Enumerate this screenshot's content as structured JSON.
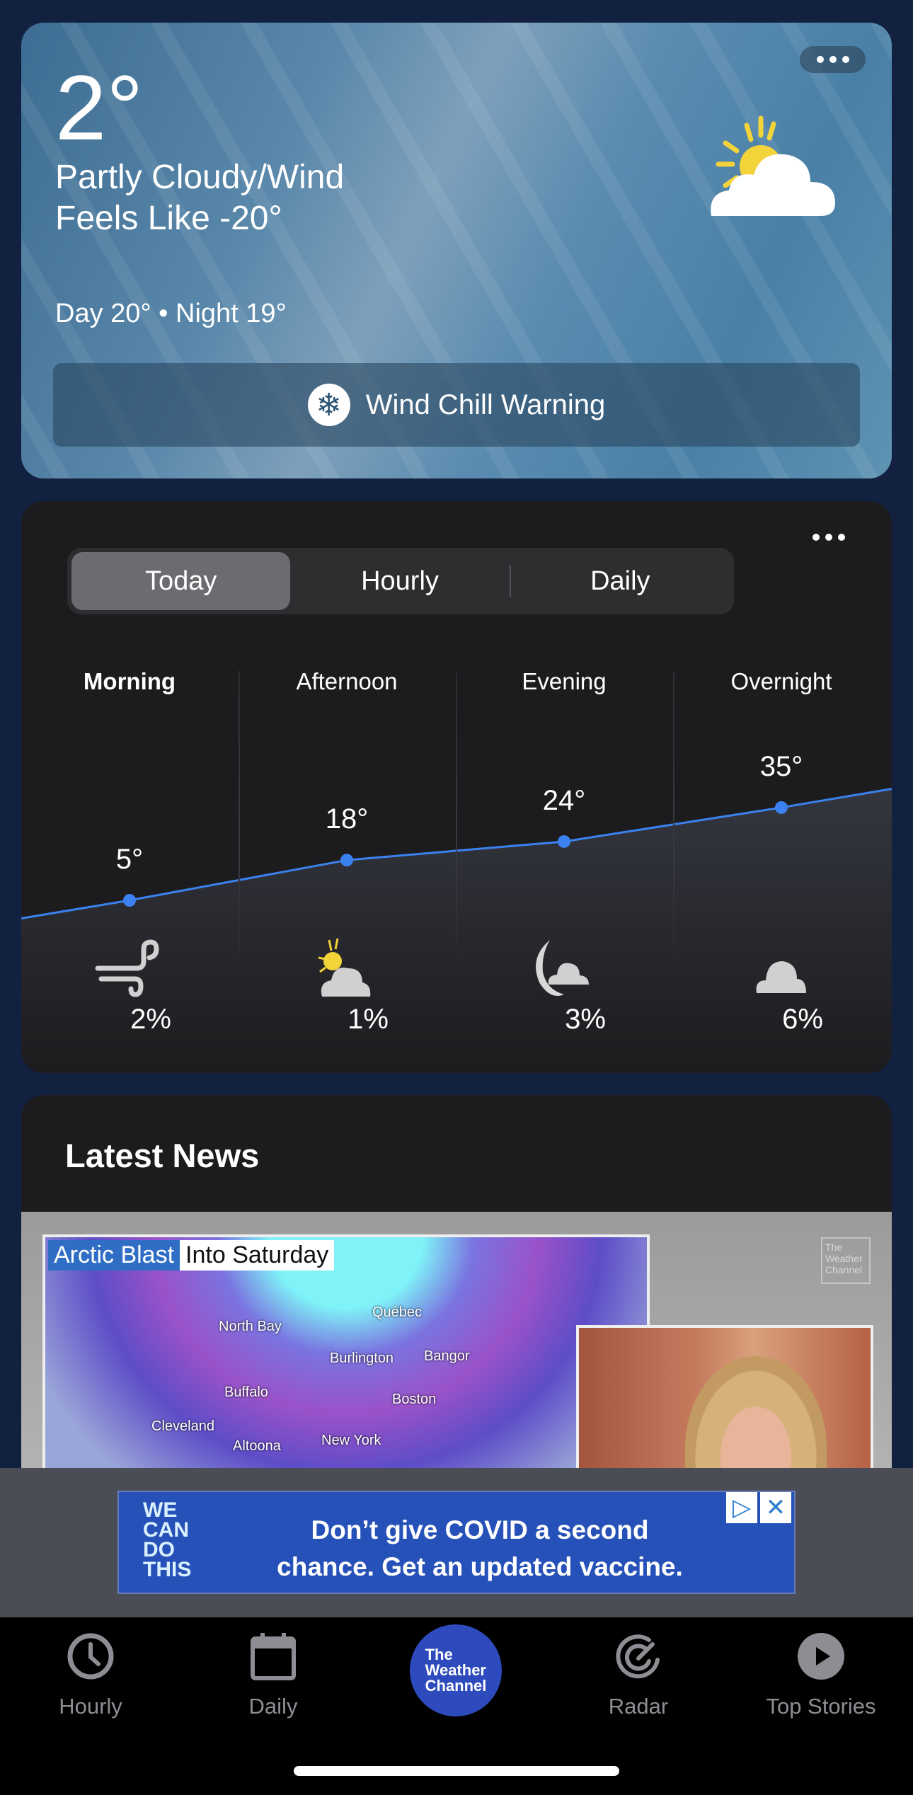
{
  "current": {
    "temperature": "2°",
    "condition": "Partly Cloudy/Wind",
    "feels_like": "Feels Like -20°",
    "day_night": "Day 20° • Night 19°",
    "icon": "partly-cloudy-icon",
    "alert": "Wind Chill Warning",
    "alert_icon": "snowflake-icon"
  },
  "today_card": {
    "tabs": [
      {
        "label": "Today",
        "selected": true
      },
      {
        "label": "Hourly",
        "selected": false
      },
      {
        "label": "Daily",
        "selected": false
      }
    ],
    "periods": [
      {
        "label": "Morning",
        "temp": "5°",
        "temp_value": 5,
        "icon": "wind-icon",
        "precip": "2%",
        "active": true
      },
      {
        "label": "Afternoon",
        "temp": "18°",
        "temp_value": 18,
        "icon": "partly-cloudy-icon",
        "precip": "1%",
        "active": false
      },
      {
        "label": "Evening",
        "temp": "24°",
        "temp_value": 24,
        "icon": "partly-cloudy-night-icon",
        "precip": "3%",
        "active": false
      },
      {
        "label": "Overnight",
        "temp": "35°",
        "temp_value": 35,
        "icon": "cloudy-icon",
        "precip": "6%",
        "active": false
      }
    ],
    "line_color": "#3b82f0"
  },
  "news": {
    "title": "Latest News",
    "video": {
      "banner_highlight": "Arctic Blast",
      "banner_rest": "Into Saturday",
      "cities": [
        "North Bay",
        "Québec",
        "Burlington",
        "Bangor",
        "Buffalo",
        "Boston",
        "Cleveland",
        "Altoona",
        "New York"
      ],
      "watermark": "The Weather Channel"
    }
  },
  "ad": {
    "logo": "WE CAN DO THIS",
    "line1": "Don’t give COVID a second",
    "line2": "chance. Get an updated vaccine."
  },
  "tabbar": {
    "items": [
      {
        "label": "Hourly"
      },
      {
        "label": "Daily"
      },
      {
        "label": "The Weather Channel"
      },
      {
        "label": "Radar"
      },
      {
        "label": "Top Stories"
      }
    ],
    "logo_lines": [
      "The",
      "Weather",
      "Channel"
    ]
  }
}
